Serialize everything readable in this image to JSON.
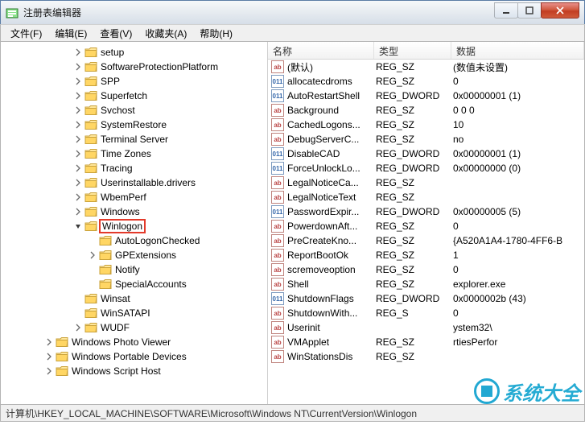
{
  "title": "注册表编辑器",
  "menu": [
    "文件(F)",
    "编辑(E)",
    "查看(V)",
    "收藏夹(A)",
    "帮助(H)"
  ],
  "statusbar": "计算机\\HKEY_LOCAL_MACHINE\\SOFTWARE\\Microsoft\\Windows NT\\CurrentVersion\\Winlogon",
  "tree": [
    {
      "indent": 5,
      "exp": "right",
      "label": "setup"
    },
    {
      "indent": 5,
      "exp": "right",
      "label": "SoftwareProtectionPlatform"
    },
    {
      "indent": 5,
      "exp": "right",
      "label": "SPP"
    },
    {
      "indent": 5,
      "exp": "right",
      "label": "Superfetch"
    },
    {
      "indent": 5,
      "exp": "right",
      "label": "Svchost"
    },
    {
      "indent": 5,
      "exp": "right",
      "label": "SystemRestore"
    },
    {
      "indent": 5,
      "exp": "right",
      "label": "Terminal Server"
    },
    {
      "indent": 5,
      "exp": "right",
      "label": "Time Zones"
    },
    {
      "indent": 5,
      "exp": "right",
      "label": "Tracing"
    },
    {
      "indent": 5,
      "exp": "right",
      "label": "Userinstallable.drivers"
    },
    {
      "indent": 5,
      "exp": "right",
      "label": "WbemPerf"
    },
    {
      "indent": 5,
      "exp": "right",
      "label": "Windows"
    },
    {
      "indent": 5,
      "exp": "down",
      "label": "Winlogon",
      "selected": true
    },
    {
      "indent": 6,
      "exp": "none",
      "label": "AutoLogonChecked"
    },
    {
      "indent": 6,
      "exp": "right",
      "label": "GPExtensions"
    },
    {
      "indent": 6,
      "exp": "none",
      "label": "Notify"
    },
    {
      "indent": 6,
      "exp": "none",
      "label": "SpecialAccounts"
    },
    {
      "indent": 5,
      "exp": "none",
      "label": "Winsat"
    },
    {
      "indent": 5,
      "exp": "none",
      "label": "WinSATAPI"
    },
    {
      "indent": 5,
      "exp": "right",
      "label": "WUDF"
    },
    {
      "indent": 3,
      "exp": "right",
      "label": "Windows Photo Viewer"
    },
    {
      "indent": 3,
      "exp": "right",
      "label": "Windows Portable Devices"
    },
    {
      "indent": 3,
      "exp": "right",
      "label": "Windows Script Host"
    }
  ],
  "columns": {
    "name": "名称",
    "type": "类型",
    "data": "数据"
  },
  "values": [
    {
      "icon": "str",
      "name": "(默认)",
      "type": "REG_SZ",
      "data": "(数值未设置)"
    },
    {
      "icon": "bin",
      "name": "allocatecdroms",
      "type": "REG_SZ",
      "data": "0"
    },
    {
      "icon": "bin",
      "name": "AutoRestartShell",
      "type": "REG_DWORD",
      "data": "0x00000001 (1)"
    },
    {
      "icon": "str",
      "name": "Background",
      "type": "REG_SZ",
      "data": "0 0 0"
    },
    {
      "icon": "str",
      "name": "CachedLogons...",
      "type": "REG_SZ",
      "data": "10"
    },
    {
      "icon": "str",
      "name": "DebugServerC...",
      "type": "REG_SZ",
      "data": "no"
    },
    {
      "icon": "bin",
      "name": "DisableCAD",
      "type": "REG_DWORD",
      "data": "0x00000001 (1)"
    },
    {
      "icon": "bin",
      "name": "ForceUnlockLo...",
      "type": "REG_DWORD",
      "data": "0x00000000 (0)"
    },
    {
      "icon": "str",
      "name": "LegalNoticeCa...",
      "type": "REG_SZ",
      "data": ""
    },
    {
      "icon": "str",
      "name": "LegalNoticeText",
      "type": "REG_SZ",
      "data": ""
    },
    {
      "icon": "bin",
      "name": "PasswordExpir...",
      "type": "REG_DWORD",
      "data": "0x00000005 (5)"
    },
    {
      "icon": "str",
      "name": "PowerdownAft...",
      "type": "REG_SZ",
      "data": "0"
    },
    {
      "icon": "str",
      "name": "PreCreateKno...",
      "type": "REG_SZ",
      "data": "{A520A1A4-1780-4FF6-B"
    },
    {
      "icon": "str",
      "name": "ReportBootOk",
      "type": "REG_SZ",
      "data": "1"
    },
    {
      "icon": "str",
      "name": "scremoveoption",
      "type": "REG_SZ",
      "data": "0"
    },
    {
      "icon": "str",
      "name": "Shell",
      "type": "REG_SZ",
      "data": "explorer.exe"
    },
    {
      "icon": "bin",
      "name": "ShutdownFlags",
      "type": "REG_DWORD",
      "data": "0x0000002b (43)"
    },
    {
      "icon": "str",
      "name": "ShutdownWith...",
      "type": "REG_S",
      "data": "0"
    },
    {
      "icon": "str",
      "name": "Userinit",
      "type": "",
      "data": "ystem32\\"
    },
    {
      "icon": "str",
      "name": "VMApplet",
      "type": "REG_SZ",
      "data": "rtiesPerfor"
    },
    {
      "icon": "str",
      "name": "WinStationsDis",
      "type": "REG_SZ",
      "data": ""
    }
  ],
  "watermark": {
    "text": "系统大全",
    "sub": ""
  }
}
